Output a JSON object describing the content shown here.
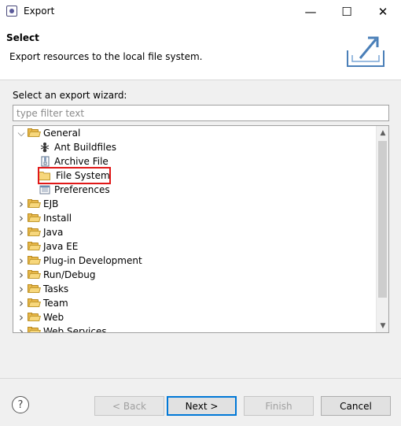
{
  "window": {
    "title": "Export",
    "minimize_glyph": "—",
    "maximize_glyph": "☐",
    "close_glyph": "✕"
  },
  "header": {
    "title": "Select",
    "description": "Export resources to the local file system."
  },
  "wizard": {
    "label": "Select an export wizard:",
    "filter_placeholder": "type filter text",
    "tree": [
      {
        "label": "General",
        "expanded": true,
        "children": [
          {
            "label": "Ant Buildfiles",
            "icon": "ant-icon"
          },
          {
            "label": "Archive File",
            "icon": "archive-icon"
          },
          {
            "label": "File System",
            "icon": "folder-icon",
            "selected": true
          },
          {
            "label": "Preferences",
            "icon": "preferences-icon"
          }
        ]
      },
      {
        "label": "EJB"
      },
      {
        "label": "Install"
      },
      {
        "label": "Java"
      },
      {
        "label": "Java EE"
      },
      {
        "label": "Plug-in Development"
      },
      {
        "label": "Run/Debug"
      },
      {
        "label": "Tasks"
      },
      {
        "label": "Team"
      },
      {
        "label": "Web"
      },
      {
        "label": "Web Services"
      }
    ]
  },
  "buttons": {
    "help": "?",
    "back": "< Back",
    "next": "Next >",
    "finish": "Finish",
    "cancel": "Cancel"
  }
}
